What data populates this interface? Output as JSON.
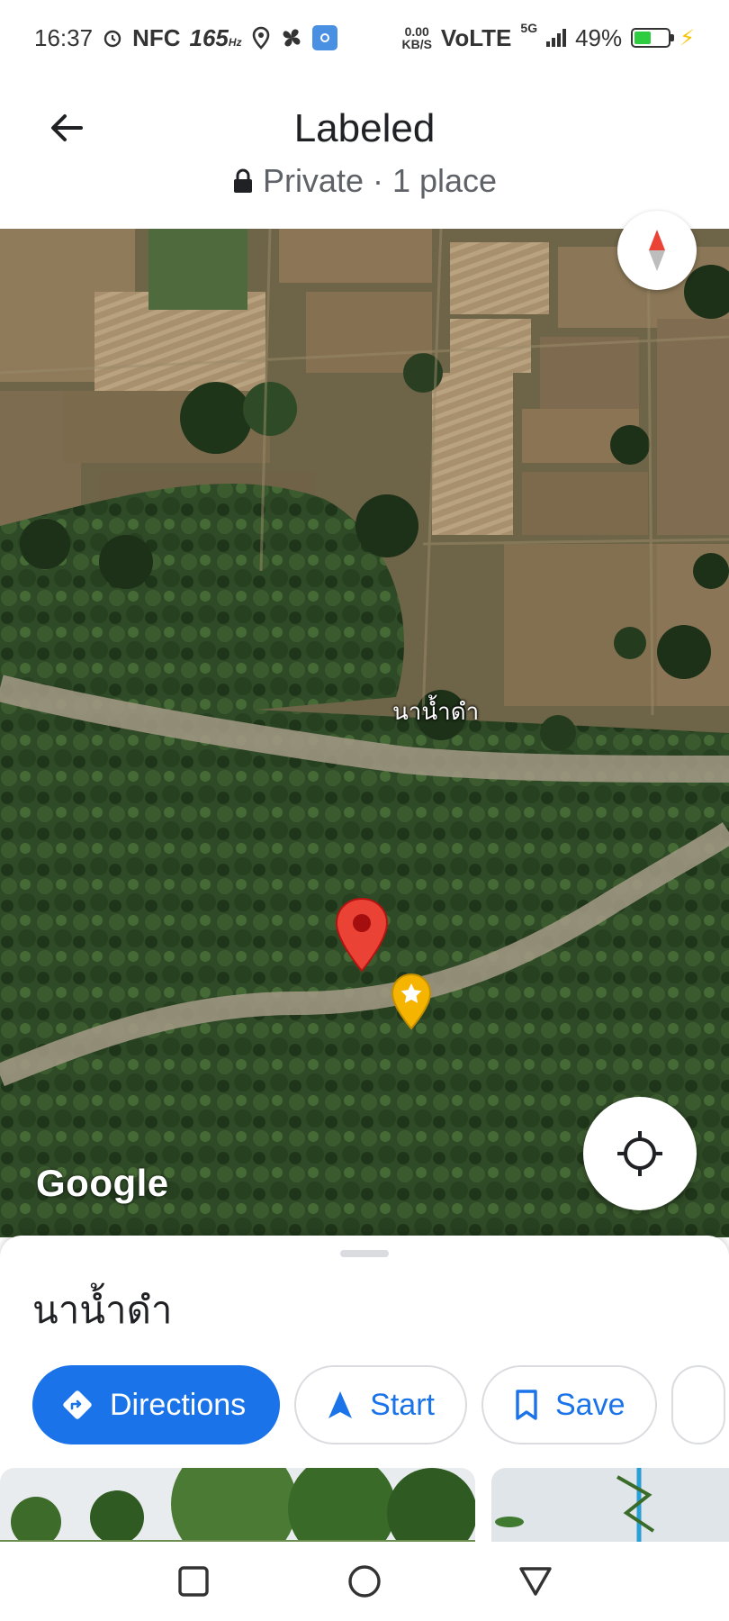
{
  "status_bar": {
    "time": "16:37",
    "nfc": "NFC",
    "refresh_rate": "165",
    "refresh_unit": "Hz",
    "speed_value": "0.00",
    "speed_unit": "KB/S",
    "network": "VoLTE",
    "signal_type": "5G",
    "battery": "49%"
  },
  "header": {
    "title": "Labeled",
    "visibility": "Private",
    "place_count": "· 1 place"
  },
  "map": {
    "pin_label": "นาน้ำดำ",
    "wordmark": "Google"
  },
  "sheet": {
    "place_name": "นาน้ำดำ",
    "actions": {
      "directions": "Directions",
      "start": "Start",
      "save": "Save"
    }
  },
  "colors": {
    "accent": "#1a73e8",
    "pin_red": "#ea4335",
    "star_yellow": "#f4b400"
  }
}
